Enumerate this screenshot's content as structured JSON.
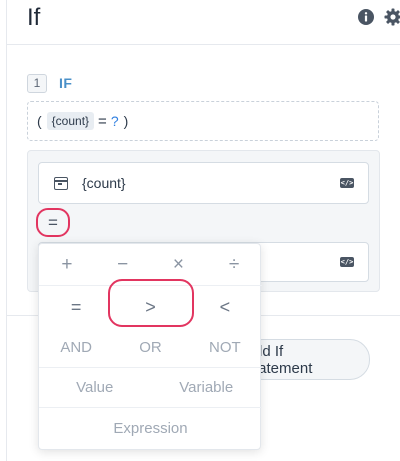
{
  "header": {
    "title": "If",
    "info_icon": "info-icon",
    "settings_icon": "gear-icon"
  },
  "condition": {
    "number": "1",
    "label": "IF",
    "expression": {
      "open_paren": "(",
      "token": "{count}",
      "operator": "=",
      "value_placeholder": "?",
      "close_paren": ")"
    }
  },
  "editor": {
    "variable_field": {
      "icon": "terminal-icon",
      "value": "{count}",
      "code_icon": "code-icon"
    },
    "operator_button": "=",
    "second_field": {
      "code_icon": "code-icon"
    }
  },
  "add_button": {
    "label": "Add If Statement"
  },
  "operator_menu": {
    "arithmetic": [
      "+",
      "−",
      "×",
      "÷"
    ],
    "comparison": [
      "=",
      ">",
      "<"
    ],
    "selected": ">",
    "logical": [
      "AND",
      "OR",
      "NOT"
    ],
    "insert": [
      "Value",
      "Variable"
    ],
    "expression": "Expression"
  },
  "colors": {
    "highlight": "#e23560",
    "accent_blue": "#4a90c8"
  }
}
